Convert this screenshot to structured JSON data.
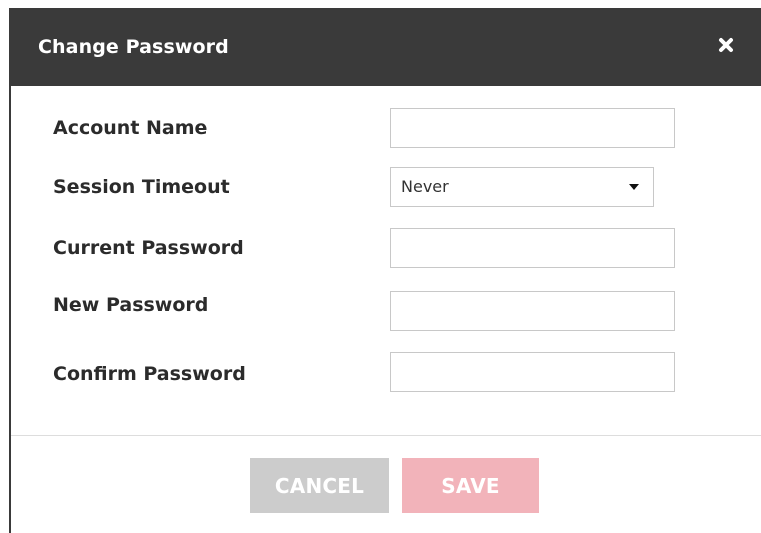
{
  "dialog": {
    "title": "Change Password",
    "close_icon": "close-icon"
  },
  "form": {
    "account_name": {
      "label": "Account Name",
      "value": "",
      "placeholder": ""
    },
    "session_timeout": {
      "label": "Session Timeout",
      "selected": "Never",
      "icon": "caret-down-icon"
    },
    "current_password": {
      "label": "Current Password",
      "value": "",
      "placeholder": ""
    },
    "new_password": {
      "label": "New Password",
      "value": "",
      "placeholder": ""
    },
    "confirm_password": {
      "label": "Confirm Password",
      "value": "",
      "placeholder": ""
    }
  },
  "footer": {
    "cancel_label": "CANCEL",
    "save_label": "SAVE"
  },
  "colors": {
    "header_bg": "#3a3a3a",
    "cancel_bg": "#cccccc",
    "save_bg": "#f2b3ba"
  }
}
